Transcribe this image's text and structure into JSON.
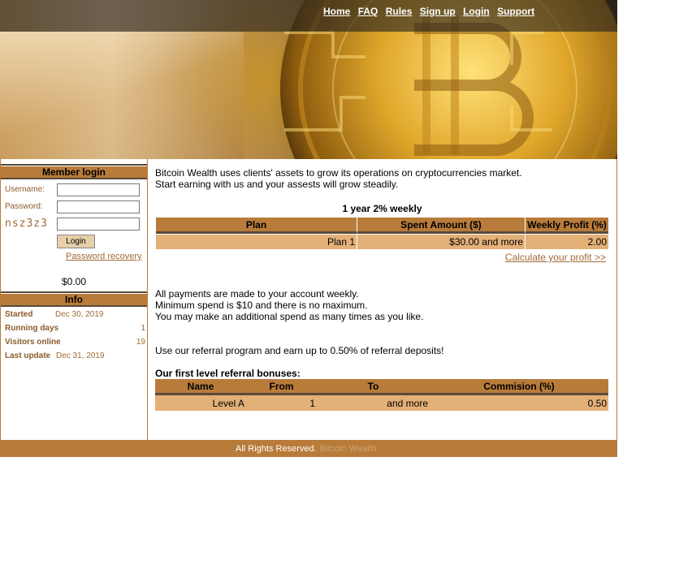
{
  "nav": [
    "Home",
    "FAQ",
    "Rules",
    "Sign up",
    "Login",
    "Support"
  ],
  "sidebar": {
    "login_title": "Member login",
    "username_label": "Username:",
    "password_label": "Password:",
    "captcha_text": "nsz3z3",
    "login_button": "Login",
    "password_recovery": "Password recovery",
    "balance": "$0.00",
    "info_title": "Info",
    "info": [
      {
        "label": "Started",
        "value": "Dec 30, 2019"
      },
      {
        "label": "Running days",
        "value": "1"
      },
      {
        "label": "Visitors online",
        "value": "19"
      },
      {
        "label": "Last update",
        "value": "Dec 31, 2019"
      }
    ]
  },
  "main": {
    "intro_line1": "Bitcoin Wealth uses clients' assets to grow its operations on cryptocurrencies market.",
    "intro_line2": "Start earning with us and your assests will grow steadily.",
    "plan_title": "1 year 2% weekly",
    "plan_headers": [
      "Plan",
      "Spent Amount ($)",
      "Weekly Profit (%)"
    ],
    "plan_row": [
      "Plan 1",
      "$30.00 and more",
      "2.00"
    ],
    "calc_link": "Calculate your profit >>",
    "payments_line1": "All payments are made to your account weekly.",
    "payments_line2": "Minimum spend is $10 and there is no maximum.",
    "payments_line3": "You may make an additional spend as many times as you like.",
    "referral_text": "Use our referral program and earn up to 0.50% of referral deposits!",
    "referral_title": "Our first level referral bonuses:",
    "ref_headers": [
      "Name",
      "From",
      "To",
      "Commision (%)"
    ],
    "ref_row": [
      "Level A",
      "1",
      "and more",
      "0.50"
    ]
  },
  "footer": {
    "text": "All Rights Reserved.",
    "faint": "Bitcoin Wealth"
  },
  "colors": {
    "accent": "#b87b3a",
    "accent_light": "#e3b078",
    "link": "#a06a36"
  }
}
